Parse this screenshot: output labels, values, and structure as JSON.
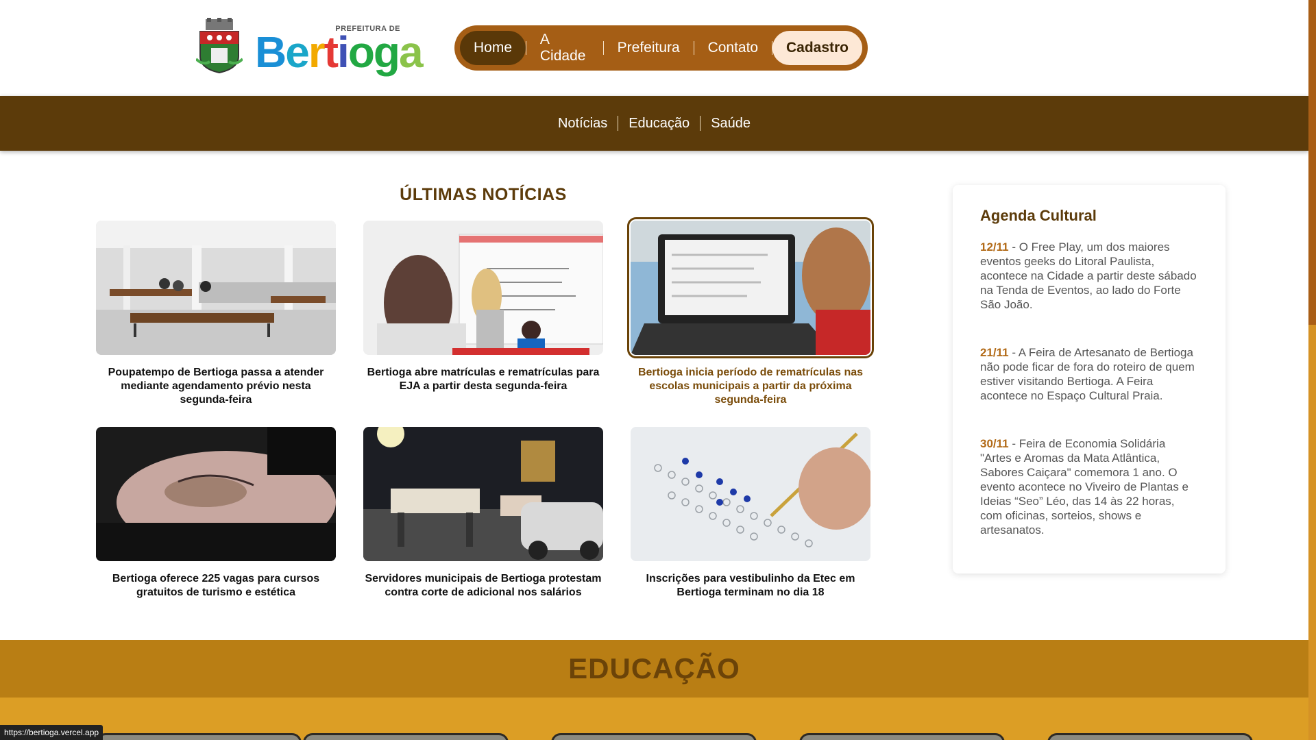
{
  "header": {
    "logo_prefix": "PREFEITURA DE",
    "logo_letters": [
      "B",
      "e",
      "r",
      "t",
      "i",
      "o",
      "g",
      "a"
    ],
    "nav": [
      {
        "label": "Home",
        "active": true
      },
      {
        "label": "A Cidade"
      },
      {
        "label": "Prefeitura"
      },
      {
        "label": "Contato"
      },
      {
        "label": "Cadastro",
        "highlight": true
      }
    ]
  },
  "subnav": [
    "Notícias",
    "Educação",
    "Saúde"
  ],
  "news": {
    "title": "ÚLTIMAS NOTÍCIAS",
    "items": [
      {
        "caption": "Poupatempo de Bertioga passa a atender mediante agendamento prévio nesta segunda-feira"
      },
      {
        "caption": "Bertioga abre matrículas e rematrículas para EJA a partir desta segunda-feira"
      },
      {
        "caption": "Bertioga inicia período de rematrículas nas escolas municipais a partir da próxima segunda-feira"
      },
      {
        "caption": "Bertioga oferece 225 vagas para cursos gratuitos de turismo e estética"
      },
      {
        "caption": "Servidores municipais de Bertioga protestam contra corte de adicional nos salários"
      },
      {
        "caption": "Inscrições para vestibulinho da Etec em Bertioga terminam no dia 18"
      }
    ]
  },
  "agenda": {
    "title": "Agenda Cultural",
    "events": [
      {
        "date": "12/11",
        "text": " - O Free Play, um dos maiores eventos geeks do Litoral Paulista, acontece na Cidade a partir deste sábado na Tenda de Eventos, ao lado do Forte São João."
      },
      {
        "date": "21/11",
        "text": " - A Feira de Artesanato de Bertioga não pode ficar de fora do roteiro de quem estiver visitando Bertioga. A Feira acontece no Espaço Cultural Praia."
      },
      {
        "date": "30/11",
        "text": " - Feira de Economia Solidária \"Artes e Aromas da Mata Atlântica, Sabores Caiçara\" comemora 1 ano. O evento acontece no Viveiro de Plantas e Ideias “Seo” Léo, das 14 às 22 horas, com oficinas, sorteios, shows e artesanatos."
      }
    ]
  },
  "education": {
    "title": "EDUCAÇÃO"
  },
  "status_url": "https://bertioga.vercel.app",
  "colors": {
    "brown_dark": "#5c3b0a",
    "brown": "#a55e15",
    "gold": "#dc9e25"
  }
}
